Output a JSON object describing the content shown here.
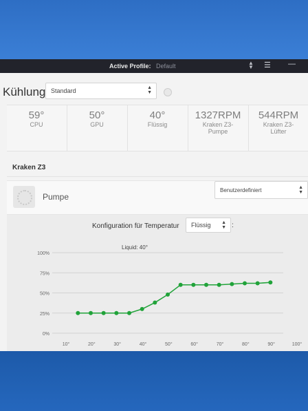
{
  "titlebar": {
    "profile_label": "Active Profile:",
    "profile_value": "Default"
  },
  "cooling": {
    "title": "Kühlung",
    "mode_value": "Standard"
  },
  "stats": [
    {
      "value": "59°",
      "label": "CPU"
    },
    {
      "value": "50°",
      "label": "GPU"
    },
    {
      "value": "40°",
      "label": "Flüssig"
    },
    {
      "value": "1327RPM",
      "label": "Kraken Z3-\nPumpe"
    },
    {
      "value": "544RPM",
      "label": "Kraken Z3-\nLüfter"
    }
  ],
  "device": {
    "name": "Kraken Z3"
  },
  "pump": {
    "label": "Pumpe",
    "mode_value": "Benutzerdefiniert"
  },
  "config": {
    "label": "Konfiguration für Temperatur",
    "source_value": "Flüssig",
    "colon": ":"
  },
  "colors": {
    "accent": "#21a33a",
    "titlebar": "#22232b"
  },
  "chart_data": {
    "type": "line",
    "annotation": "Liquid: 40°",
    "x_ticks": [
      "10°",
      "20°",
      "30°",
      "40°",
      "50°",
      "60°",
      "70°",
      "80°",
      "90°",
      "100°"
    ],
    "y_ticks": [
      "0%",
      "25%",
      "50%",
      "75%",
      "100%"
    ],
    "xlim": [
      10,
      100
    ],
    "ylim": [
      0,
      100
    ],
    "grid": true,
    "series": [
      {
        "points": [
          [
            20,
            25
          ],
          [
            25,
            25
          ],
          [
            30,
            25
          ],
          [
            35,
            25
          ],
          [
            40,
            25
          ],
          [
            45,
            30
          ],
          [
            50,
            38
          ],
          [
            55,
            48
          ],
          [
            60,
            60
          ],
          [
            65,
            60
          ],
          [
            70,
            60
          ],
          [
            75,
            60
          ],
          [
            80,
            61
          ],
          [
            85,
            62
          ],
          [
            90,
            62
          ],
          [
            95,
            63
          ]
        ]
      }
    ]
  }
}
